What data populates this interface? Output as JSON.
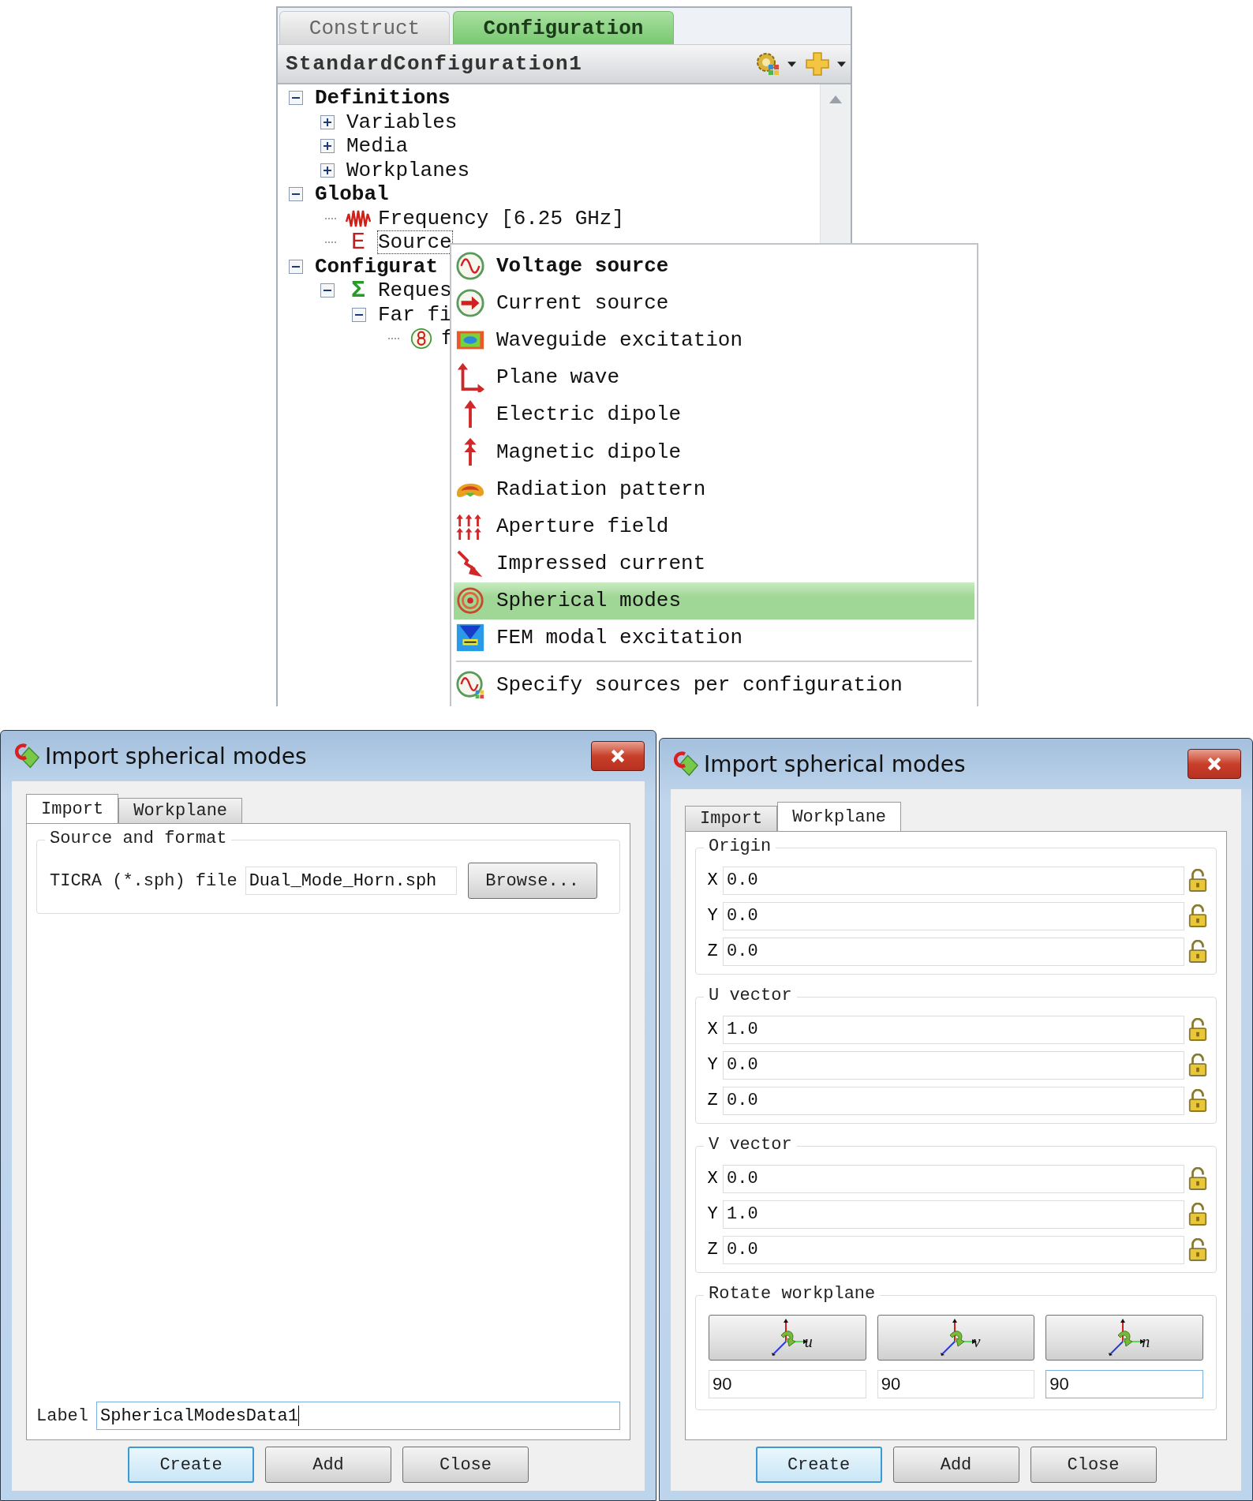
{
  "panel": {
    "tabs": [
      {
        "label": "Construct",
        "selected": false
      },
      {
        "label": "Configuration",
        "selected": true
      }
    ],
    "header": {
      "title": "StandardConfiguration1"
    },
    "tree": [
      {
        "label": "Definitions",
        "expanded": true,
        "selected": false,
        "children": [
          {
            "label": "Variables",
            "expanded": false,
            "selected": false
          },
          {
            "label": "Media",
            "expanded": false,
            "selected": false
          },
          {
            "label": "Workplanes",
            "expanded": false,
            "selected": false
          }
        ]
      },
      {
        "label": "Global",
        "expanded": true,
        "selected": false,
        "children": [
          {
            "label": "Frequency [6.25 GHz]",
            "kind": "wave",
            "selected": false
          },
          {
            "label": "Source",
            "kind": "glyph",
            "icon_text": "E",
            "selected": true
          }
        ]
      },
      {
        "label": "Configurat",
        "expanded": true,
        "selected": false,
        "children": [
          {
            "label": "Reques",
            "kind": "glyph",
            "icon_text": "Σ",
            "expanded": true,
            "selected": false,
            "children": [
              {
                "label": "Far fi",
                "expanded": true,
                "selected": false,
                "children": [
                  {
                    "label": "f",
                    "kind": "farfield",
                    "selected": false
                  }
                ]
              }
            ]
          }
        ]
      }
    ]
  },
  "menu": {
    "items": [
      {
        "label": "Voltage source",
        "kind": "voltage",
        "default": true,
        "selected": false
      },
      {
        "label": "Current source",
        "kind": "current",
        "default": false,
        "selected": false
      },
      {
        "label": "Waveguide excitation",
        "kind": "waveguide",
        "default": false,
        "selected": false
      },
      {
        "label": "Plane wave",
        "kind": "planewave",
        "default": false,
        "selected": false
      },
      {
        "label": "Electric dipole",
        "kind": "edipole",
        "default": false,
        "selected": false
      },
      {
        "label": "Magnetic dipole",
        "kind": "mdipole",
        "default": false,
        "selected": false
      },
      {
        "label": "Radiation pattern",
        "kind": "radiation",
        "default": false,
        "selected": false
      },
      {
        "label": "Aperture field",
        "kind": "aperture",
        "default": false,
        "selected": false
      },
      {
        "label": "Impressed current",
        "kind": "impressed",
        "default": false,
        "selected": false
      },
      {
        "label": "Spherical modes",
        "kind": "spherical",
        "default": false,
        "selected": true
      },
      {
        "label": "FEM modal excitation",
        "kind": "fem",
        "default": false,
        "selected": false
      }
    ],
    "extra_items": [
      {
        "label": "Specify sources per configuration",
        "kind": "specify",
        "default": false,
        "selected": false
      }
    ]
  },
  "dialogs": [
    {
      "kind": "import",
      "title": "Import spherical modes",
      "tabs": [
        {
          "label": "Import",
          "selected": true
        },
        {
          "label": "Workplane",
          "selected": false
        }
      ],
      "group": {
        "title": "Source and format",
        "file_label": "TICRA (*.sph) file",
        "file_value": "Dual_Mode_Horn.sph",
        "browse": "Browse..."
      },
      "label": {
        "text": "Label",
        "value": "SphericalModesData1",
        "focused": true
      },
      "buttons": [
        {
          "label": "Create",
          "default": true
        },
        {
          "label": "Add",
          "default": false
        },
        {
          "label": "Close",
          "default": false
        }
      ]
    },
    {
      "kind": "workplane",
      "title": "Import spherical modes",
      "tabs": [
        {
          "label": "Import",
          "selected": false
        },
        {
          "label": "Workplane",
          "selected": true
        }
      ],
      "groups": [
        {
          "title": "Origin",
          "rows": [
            {
              "axis": "X",
              "value": "0.0"
            },
            {
              "axis": "Y",
              "value": "0.0"
            },
            {
              "axis": "Z",
              "value": "0.0"
            }
          ]
        },
        {
          "title": "U vector",
          "rows": [
            {
              "axis": "X",
              "value": "1.0"
            },
            {
              "axis": "Y",
              "value": "0.0"
            },
            {
              "axis": "Z",
              "value": "0.0"
            }
          ]
        },
        {
          "title": "V vector",
          "rows": [
            {
              "axis": "X",
              "value": "0.0"
            },
            {
              "axis": "Y",
              "value": "1.0"
            },
            {
              "axis": "Z",
              "value": "0.0"
            }
          ]
        }
      ],
      "rotate": {
        "title": "Rotate workplane",
        "axes": [
          {
            "letter": "u",
            "value": "90",
            "focused": false
          },
          {
            "letter": "v",
            "value": "90",
            "focused": false
          },
          {
            "letter": "n",
            "value": "90",
            "focused": true
          }
        ]
      },
      "buttons": [
        {
          "label": "Create",
          "default": true
        },
        {
          "label": "Add",
          "default": false
        },
        {
          "label": "Close",
          "default": false
        }
      ]
    }
  ]
}
